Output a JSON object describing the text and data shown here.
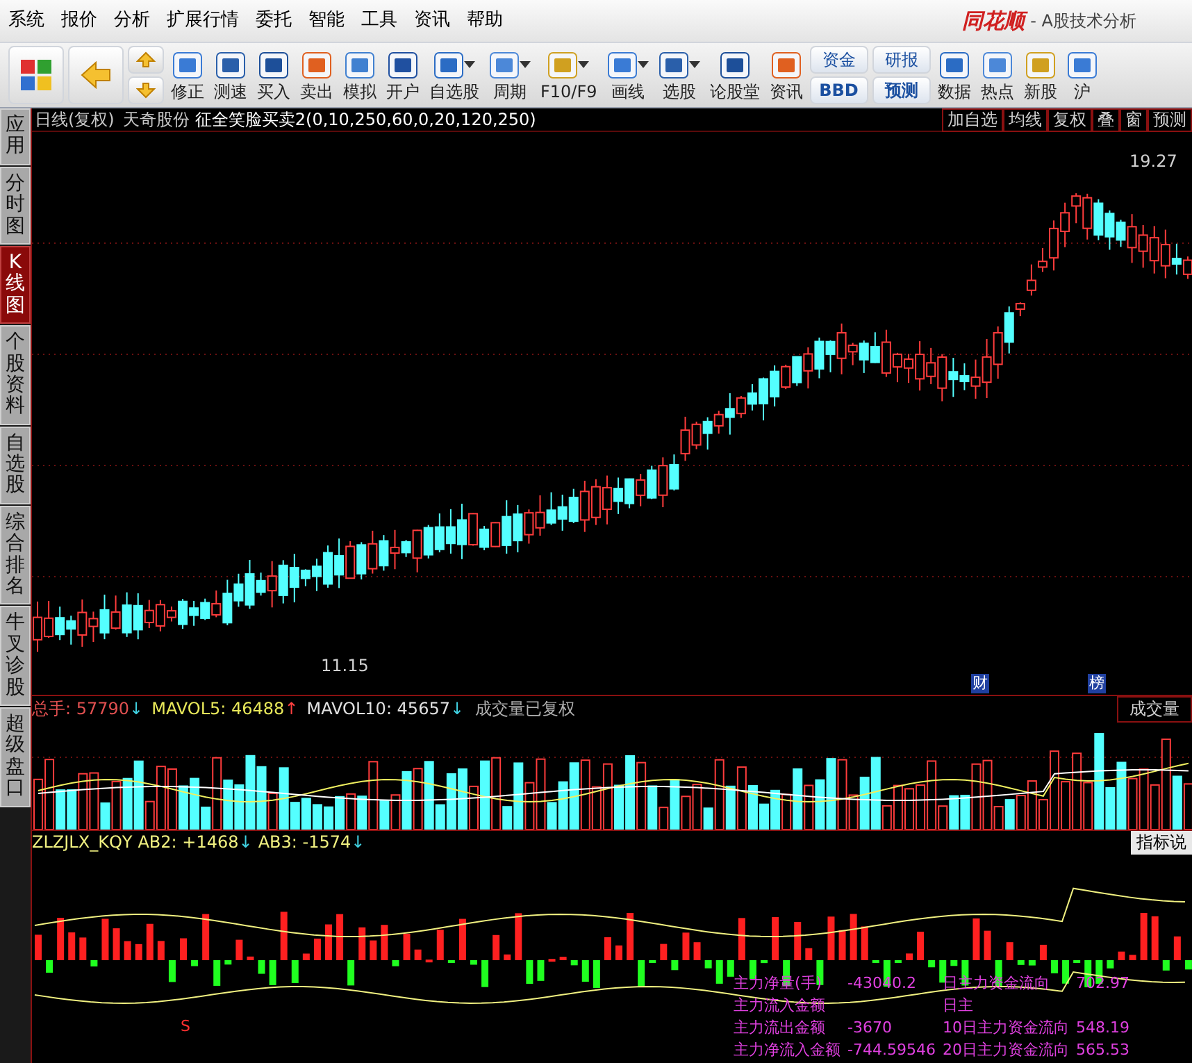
{
  "menu": [
    "系统",
    "报价",
    "分析",
    "扩展行情",
    "委托",
    "智能",
    "工具",
    "资讯",
    "帮助"
  ],
  "brand": {
    "logo": "同花顺",
    "subtitle": "- A股技术分析"
  },
  "toolbar": [
    {
      "kind": "icon"
    },
    {
      "kind": "icon"
    },
    {
      "kind": "updown"
    },
    {
      "kind": "labeled",
      "label": "修正"
    },
    {
      "kind": "labeled",
      "label": "测速"
    },
    {
      "kind": "labeled",
      "label": "买入"
    },
    {
      "kind": "labeled",
      "label": "卖出"
    },
    {
      "kind": "labeled",
      "label": "模拟"
    },
    {
      "kind": "labeled",
      "label": "开户"
    },
    {
      "kind": "dropdown",
      "label": "自选股"
    },
    {
      "kind": "dropdown",
      "label": "周期"
    },
    {
      "kind": "dropdown",
      "label": "F10/F9"
    },
    {
      "kind": "dropdown",
      "label": "画线"
    },
    {
      "kind": "dropdown",
      "label": "选股"
    },
    {
      "kind": "labeled",
      "label": "论股堂"
    },
    {
      "kind": "labeled",
      "label": "资讯"
    },
    {
      "kind": "stacked",
      "top": "资金",
      "bottom": "BBD"
    },
    {
      "kind": "stacked",
      "top": "研报",
      "bottom": "预测"
    },
    {
      "kind": "labeled",
      "label": "数据"
    },
    {
      "kind": "labeled",
      "label": "热点"
    },
    {
      "kind": "labeled",
      "label": "新股"
    },
    {
      "kind": "labeled",
      "label": "沪"
    }
  ],
  "sidebar": [
    {
      "label": "应用",
      "selected": false
    },
    {
      "label": "分时图",
      "selected": false
    },
    {
      "label": "K线图",
      "selected": true
    },
    {
      "label": "个股资料",
      "selected": false
    },
    {
      "label": "自选股",
      "selected": false
    },
    {
      "label": "综合排名",
      "selected": false
    },
    {
      "label": "牛叉诊股",
      "selected": false
    },
    {
      "label": "超级盘口",
      "selected": false
    }
  ],
  "chart": {
    "period": "日线(复权)",
    "stock": "天奇股份",
    "indicator": "征全笑脸买卖2(0,10,250,60,0,20,120,250)",
    "buttons": [
      "加自选",
      "均线",
      "复权",
      "叠",
      "窗",
      "预测"
    ],
    "high_label": "19.27",
    "low_label": "11.15",
    "markers": [
      "财",
      "榜"
    ]
  },
  "volume": {
    "legend": [
      {
        "label": "总手: 57790",
        "arrow": "↓",
        "kind": "total"
      },
      {
        "label": "MAVOL5: 46488",
        "arrow": "↑",
        "kind": "ma5"
      },
      {
        "label": "MAVOL10: 45657",
        "arrow": "↓",
        "kind": "ma10"
      }
    ],
    "note": "成交量已复权",
    "tab": "成交量"
  },
  "indicator": {
    "name": "ZLZJLX_KQY",
    "legend": [
      {
        "label": "AB2: +1468",
        "arrow": "↓"
      },
      {
        "label": "AB3: -1574",
        "arrow": "↓"
      }
    ],
    "tab": "指标说",
    "signal": "S",
    "stats": [
      {
        "label": "主力净量(手)",
        "value": "-43040.2",
        "right_label": "日主力资金流向",
        "right_value": "702.97"
      },
      {
        "label": "主力流入金额",
        "right_label": "日主"
      },
      {
        "label": "主力流出金额",
        "value": "-3670",
        "right_label": "10日主力资金流向",
        "right_value": "548.19"
      },
      {
        "label": "主力净流入金额",
        "value": "-744.59546",
        "right_label": "20日主力资金流向",
        "right_value": "565.53"
      }
    ]
  }
}
